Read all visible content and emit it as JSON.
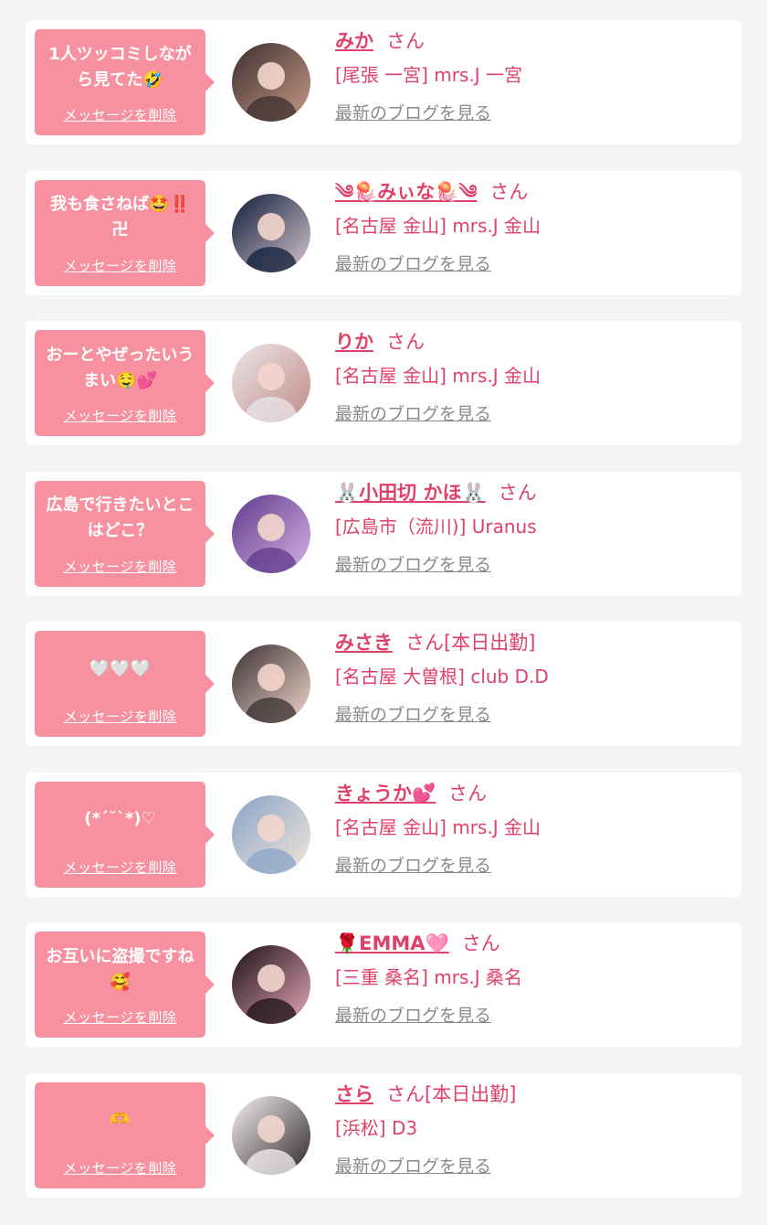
{
  "delete_label": "メッセージを削除",
  "blog_label": "最新のブログを見る",
  "san": "さん",
  "colors": {
    "accent": "#e0416a",
    "bubble": "#f7919f",
    "background": "#f4f4f4",
    "link_gray": "#8a8a8a"
  },
  "items": [
    {
      "message": "1人ツッコミしながら見てた🤣",
      "name": "みか",
      "suffix": "",
      "shop": "[尾張 一宮] mrs.J 一宮",
      "avatar": {
        "icon": "avatar-photo",
        "c1": "#3b2f2f",
        "c2": "#c99a86"
      }
    },
    {
      "message": "我も食さねば🤩‼️卍",
      "name": "༄🪼みぃな🪼༄",
      "suffix": "",
      "shop": "[名古屋 金山] mrs.J 金山",
      "avatar": {
        "icon": "avatar-photo",
        "c1": "#0f1c3a",
        "c2": "#d8c7cf"
      }
    },
    {
      "message": "おーとやぜったいうまい🤤💕",
      "name": "りか",
      "suffix": "",
      "shop": "[名古屋 金山] mrs.J 金山",
      "avatar": {
        "icon": "avatar-photo",
        "c1": "#e9e6ea",
        "c2": "#c28a86"
      }
    },
    {
      "message": "広島で行きたいとこはどこ？",
      "name": "🐰小田切 かほ🐰",
      "suffix": "",
      "shop": "[広島市（流川)] Uranus",
      "avatar": {
        "icon": "avatar-photo",
        "c1": "#5e3a8a",
        "c2": "#d7b3e8"
      }
    },
    {
      "message": "🤍🤍🤍",
      "name": "みさき",
      "suffix": "[本日出勤]",
      "shop": "[名古屋 大曽根] club D.D",
      "avatar": {
        "icon": "avatar-photo",
        "c1": "#3a3030",
        "c2": "#f2d7cf"
      }
    },
    {
      "message": "(*´˘`*)♡",
      "name": "きょうか💕",
      "suffix": "",
      "shop": "[名古屋 金山] mrs.J 金山",
      "avatar": {
        "icon": "avatar-photo",
        "c1": "#8aa4c8",
        "c2": "#f1e6d8"
      }
    },
    {
      "message": "お互いに盗撮ですね🥰",
      "name": "🌹EMMA🩷",
      "suffix": "",
      "shop": "[三重 桑名] mrs.J 桑名",
      "avatar": {
        "icon": "avatar-photo",
        "c1": "#1b1016",
        "c2": "#e6a7b8"
      }
    },
    {
      "message": "🫶",
      "name": "さら",
      "suffix": "[本日出勤]",
      "shop": "[浜松] D3",
      "avatar": {
        "icon": "avatar-photo",
        "c1": "#f6f2f4",
        "c2": "#2e2426"
      }
    }
  ]
}
